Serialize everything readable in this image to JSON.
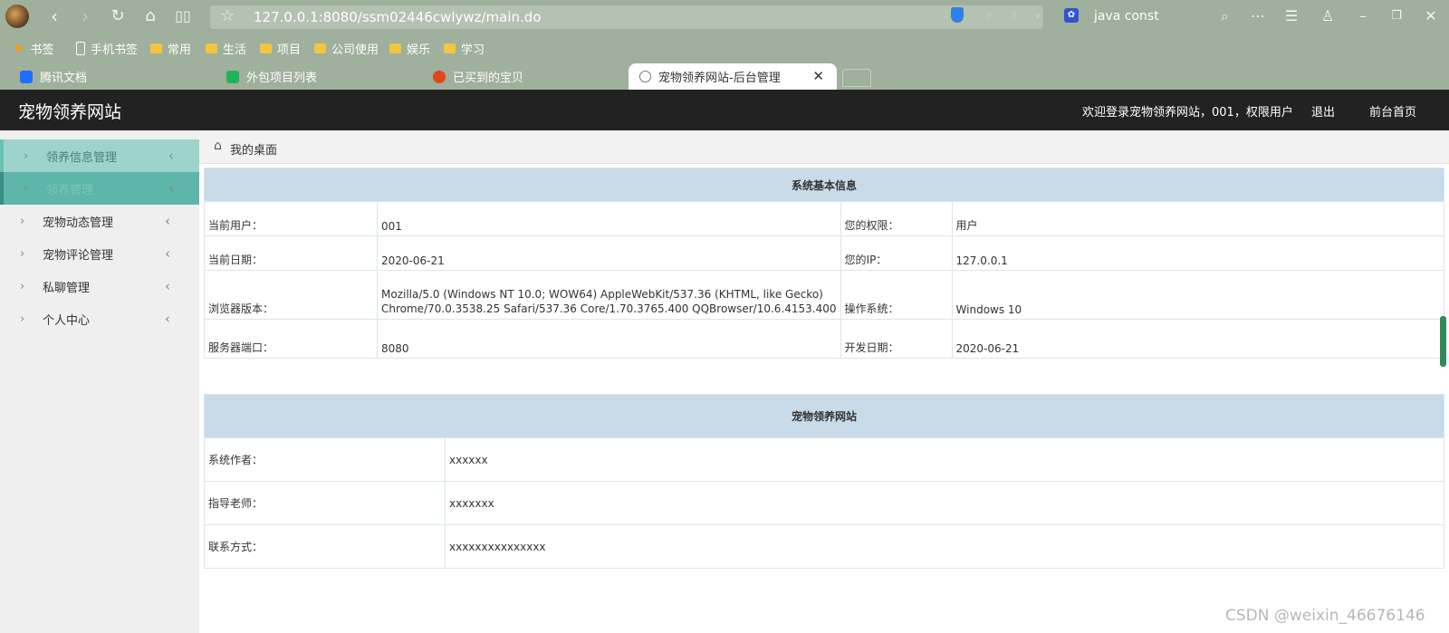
{
  "browser": {
    "url": "127.0.0.1:8080/ssm02446cwlywz/main.do",
    "search_text": "java const",
    "bookmarks": [
      "书签",
      "手机书签",
      "常用",
      "生活",
      "项目",
      "公司使用",
      "娱乐",
      "学习"
    ],
    "tabs": [
      {
        "label": "腾讯文档",
        "icon_color": "#1e6fff"
      },
      {
        "label": "外包项目列表",
        "icon_color": "#21b35a"
      },
      {
        "label": "已买到的宝贝",
        "icon_color": "#e0451b"
      },
      {
        "label": "宠物领养网站-后台管理",
        "icon_color": "#777777"
      }
    ],
    "icons": {
      "back": "back-arrow-icon",
      "forward": "forward-arrow-icon",
      "reload": "reload-icon",
      "home": "home-icon",
      "reader": "reader-icon",
      "favorite": "star-icon",
      "shield": "shield-icon",
      "search": "search-icon",
      "menu": "menu-icon",
      "minimize": "minimize-icon",
      "maximize": "restore-icon",
      "close": "close-icon"
    }
  },
  "app": {
    "title": "宠物领养网站",
    "welcome": "欢迎登录宠物领养网站，001，权限用户",
    "logout": "退出",
    "home_link": "前台首页",
    "breadcrumb": "我的桌面",
    "colors": {
      "header": "#222222",
      "sidebar": "#efefef",
      "table_header": "#c9dbe9",
      "active_menu": "#5eb5a9"
    }
  },
  "sidebar": {
    "items": [
      {
        "label": "领养信息管理"
      },
      {
        "label": "领养管理"
      },
      {
        "label": "宠物动态管理"
      },
      {
        "label": "宠物评论管理"
      },
      {
        "label": "私聊管理"
      },
      {
        "label": "个人中心"
      }
    ]
  },
  "sysinfo": {
    "header": "系统基本信息",
    "rows": [
      {
        "l1": "当前用户：",
        "v1": "001",
        "l2": "您的权限：",
        "v2": "用户"
      },
      {
        "l1": "当前日期：",
        "v1": "2020-06-21",
        "l2": "您的IP：",
        "v2": "127.0.0.1"
      },
      {
        "l1": "浏览器版本：",
        "v1a": "Mozilla/5.0 (Windows NT 10.0; WOW64) AppleWebKit/537.36 (KHTML, like Gecko)",
        "v1b": "Chrome/70.0.3538.25 Safari/537.36 Core/1.70.3765.400 QQBrowser/10.6.4153.400",
        "l2": "操作系统：",
        "v2": "Windows 10"
      },
      {
        "l1": "服务器端口：",
        "v1": "8080",
        "l2": "开发日期：",
        "v2": "2020-06-21"
      }
    ]
  },
  "siteinfo": {
    "header": "宠物领养网站",
    "rows": [
      {
        "label": "系统作者：",
        "value": "xxxxxx"
      },
      {
        "label": "指导老师：",
        "value": "xxxxxxx"
      },
      {
        "label": "联系方式：",
        "value": "xxxxxxxxxxxxxxx"
      }
    ]
  },
  "watermark": "CSDN @weixin_46676146"
}
